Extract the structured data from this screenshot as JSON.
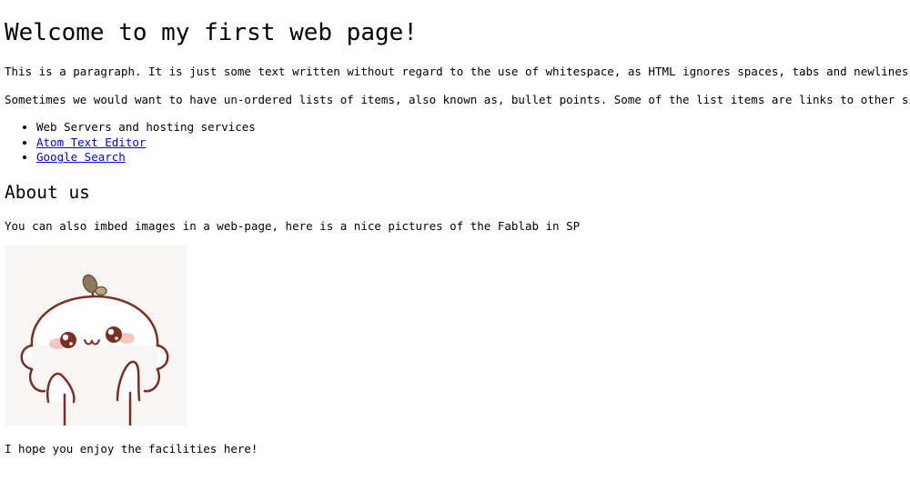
{
  "heading": "Welcome to my first web page!",
  "paragraph_1": "This is a paragraph. It is just some text written without regard to the use of whitespace, as HTML ignores spaces, tabs and newlines.",
  "paragraph_2": "Sometimes we would want to have un-ordered lists of items, also known as, bullet points. Some of the list items are links to other sites..",
  "list": {
    "items": [
      {
        "label": "Web Servers and hosting services",
        "is_link": false
      },
      {
        "label": "Atom Text Editor",
        "is_link": true
      },
      {
        "label": "Google Search",
        "is_link": true
      }
    ]
  },
  "about": {
    "heading": "About us",
    "paragraph": "You can also imbed images in a web-page, here is a nice pictures of the Fablab in SP"
  },
  "image": {
    "subject": "cute-cartoon-mochi-character"
  },
  "closing": "I hope you enjoy the facilities here!",
  "colors": {
    "link": "#0000ee",
    "text": "#000000",
    "illustration_outline": "#7a2f22",
    "illustration_blush": "#f4b8b0",
    "illustration_sprout": "#8a7a5c"
  }
}
